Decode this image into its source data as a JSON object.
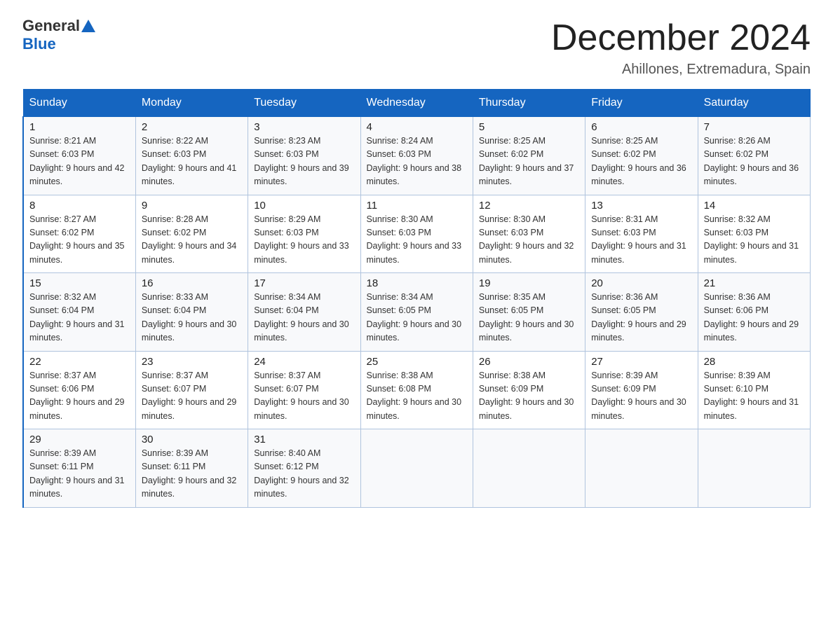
{
  "logo": {
    "general": "General",
    "blue": "Blue"
  },
  "header": {
    "month": "December 2024",
    "location": "Ahillones, Extremadura, Spain"
  },
  "weekdays": [
    "Sunday",
    "Monday",
    "Tuesday",
    "Wednesday",
    "Thursday",
    "Friday",
    "Saturday"
  ],
  "weeks": [
    [
      {
        "day": "1",
        "sunrise": "8:21 AM",
        "sunset": "6:03 PM",
        "daylight": "9 hours and 42 minutes."
      },
      {
        "day": "2",
        "sunrise": "8:22 AM",
        "sunset": "6:03 PM",
        "daylight": "9 hours and 41 minutes."
      },
      {
        "day": "3",
        "sunrise": "8:23 AM",
        "sunset": "6:03 PM",
        "daylight": "9 hours and 39 minutes."
      },
      {
        "day": "4",
        "sunrise": "8:24 AM",
        "sunset": "6:03 PM",
        "daylight": "9 hours and 38 minutes."
      },
      {
        "day": "5",
        "sunrise": "8:25 AM",
        "sunset": "6:02 PM",
        "daylight": "9 hours and 37 minutes."
      },
      {
        "day": "6",
        "sunrise": "8:25 AM",
        "sunset": "6:02 PM",
        "daylight": "9 hours and 36 minutes."
      },
      {
        "day": "7",
        "sunrise": "8:26 AM",
        "sunset": "6:02 PM",
        "daylight": "9 hours and 36 minutes."
      }
    ],
    [
      {
        "day": "8",
        "sunrise": "8:27 AM",
        "sunset": "6:02 PM",
        "daylight": "9 hours and 35 minutes."
      },
      {
        "day": "9",
        "sunrise": "8:28 AM",
        "sunset": "6:02 PM",
        "daylight": "9 hours and 34 minutes."
      },
      {
        "day": "10",
        "sunrise": "8:29 AM",
        "sunset": "6:03 PM",
        "daylight": "9 hours and 33 minutes."
      },
      {
        "day": "11",
        "sunrise": "8:30 AM",
        "sunset": "6:03 PM",
        "daylight": "9 hours and 33 minutes."
      },
      {
        "day": "12",
        "sunrise": "8:30 AM",
        "sunset": "6:03 PM",
        "daylight": "9 hours and 32 minutes."
      },
      {
        "day": "13",
        "sunrise": "8:31 AM",
        "sunset": "6:03 PM",
        "daylight": "9 hours and 31 minutes."
      },
      {
        "day": "14",
        "sunrise": "8:32 AM",
        "sunset": "6:03 PM",
        "daylight": "9 hours and 31 minutes."
      }
    ],
    [
      {
        "day": "15",
        "sunrise": "8:32 AM",
        "sunset": "6:04 PM",
        "daylight": "9 hours and 31 minutes."
      },
      {
        "day": "16",
        "sunrise": "8:33 AM",
        "sunset": "6:04 PM",
        "daylight": "9 hours and 30 minutes."
      },
      {
        "day": "17",
        "sunrise": "8:34 AM",
        "sunset": "6:04 PM",
        "daylight": "9 hours and 30 minutes."
      },
      {
        "day": "18",
        "sunrise": "8:34 AM",
        "sunset": "6:05 PM",
        "daylight": "9 hours and 30 minutes."
      },
      {
        "day": "19",
        "sunrise": "8:35 AM",
        "sunset": "6:05 PM",
        "daylight": "9 hours and 30 minutes."
      },
      {
        "day": "20",
        "sunrise": "8:36 AM",
        "sunset": "6:05 PM",
        "daylight": "9 hours and 29 minutes."
      },
      {
        "day": "21",
        "sunrise": "8:36 AM",
        "sunset": "6:06 PM",
        "daylight": "9 hours and 29 minutes."
      }
    ],
    [
      {
        "day": "22",
        "sunrise": "8:37 AM",
        "sunset": "6:06 PM",
        "daylight": "9 hours and 29 minutes."
      },
      {
        "day": "23",
        "sunrise": "8:37 AM",
        "sunset": "6:07 PM",
        "daylight": "9 hours and 29 minutes."
      },
      {
        "day": "24",
        "sunrise": "8:37 AM",
        "sunset": "6:07 PM",
        "daylight": "9 hours and 30 minutes."
      },
      {
        "day": "25",
        "sunrise": "8:38 AM",
        "sunset": "6:08 PM",
        "daylight": "9 hours and 30 minutes."
      },
      {
        "day": "26",
        "sunrise": "8:38 AM",
        "sunset": "6:09 PM",
        "daylight": "9 hours and 30 minutes."
      },
      {
        "day": "27",
        "sunrise": "8:39 AM",
        "sunset": "6:09 PM",
        "daylight": "9 hours and 30 minutes."
      },
      {
        "day": "28",
        "sunrise": "8:39 AM",
        "sunset": "6:10 PM",
        "daylight": "9 hours and 31 minutes."
      }
    ],
    [
      {
        "day": "29",
        "sunrise": "8:39 AM",
        "sunset": "6:11 PM",
        "daylight": "9 hours and 31 minutes."
      },
      {
        "day": "30",
        "sunrise": "8:39 AM",
        "sunset": "6:11 PM",
        "daylight": "9 hours and 32 minutes."
      },
      {
        "day": "31",
        "sunrise": "8:40 AM",
        "sunset": "6:12 PM",
        "daylight": "9 hours and 32 minutes."
      },
      null,
      null,
      null,
      null
    ]
  ]
}
